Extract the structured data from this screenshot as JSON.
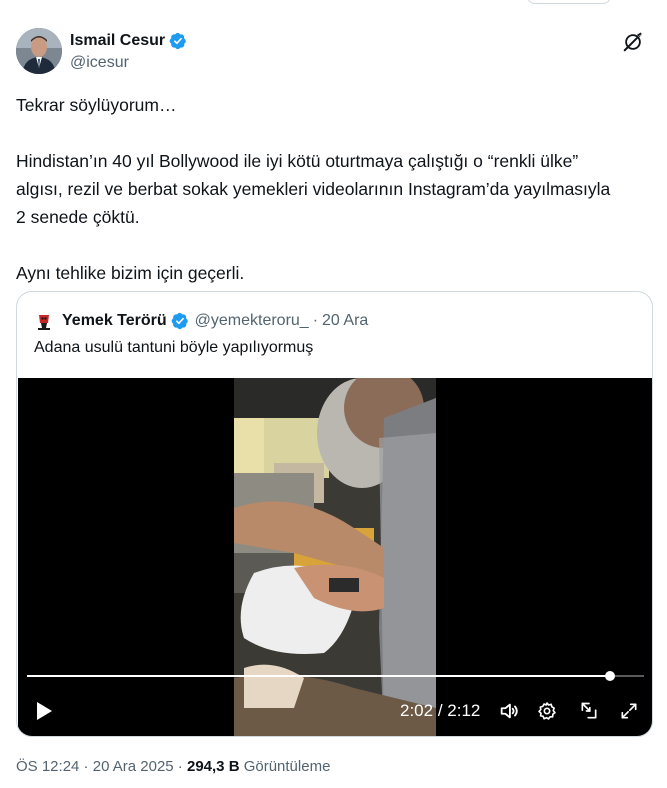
{
  "author": {
    "name": "Ismail Cesur",
    "handle": "@icesur"
  },
  "tweet": {
    "paragraphs": [
      "Tekrar söylüyorum…",
      "Hindistan’ın 40 yıl Bollywood ile iyi kötü oturtmaya çalıştığı o “renkli ülke” algısı, rezil ve berbat sokak yemekleri videolarının Instagram’da yayılmasıyla 2 senede çöktü.",
      "Aynı tehlike bizim için geçerli."
    ]
  },
  "quoted_tweet": {
    "name": "Yemek Terörü",
    "handle": "@yemekteroru_",
    "separator": "·",
    "date": "20 Ara",
    "text": "Adana usulü tantuni böyle yapılıyormuş"
  },
  "video": {
    "current_time": "2:02",
    "time_separator": " / ",
    "duration": "2:12",
    "progress_fraction": 0.945
  },
  "meta": {
    "time": "ÖS 12:24",
    "sep1": " · ",
    "date": "20 Ara 2025",
    "sep2": " · ",
    "views": "294,3 B",
    "views_label": " Görüntüleme"
  },
  "colors": {
    "verified_blue": "#1d9bf0",
    "text_primary": "#0f1419",
    "text_secondary": "#536471",
    "border": "#cfd9de"
  },
  "icons": {
    "verified": "verified-badge-icon",
    "grok": "grok-icon",
    "play": "play-icon",
    "volume": "volume-icon",
    "settings": "settings-gear-icon",
    "pip": "picture-in-picture-icon",
    "fullscreen": "fullscreen-icon"
  }
}
